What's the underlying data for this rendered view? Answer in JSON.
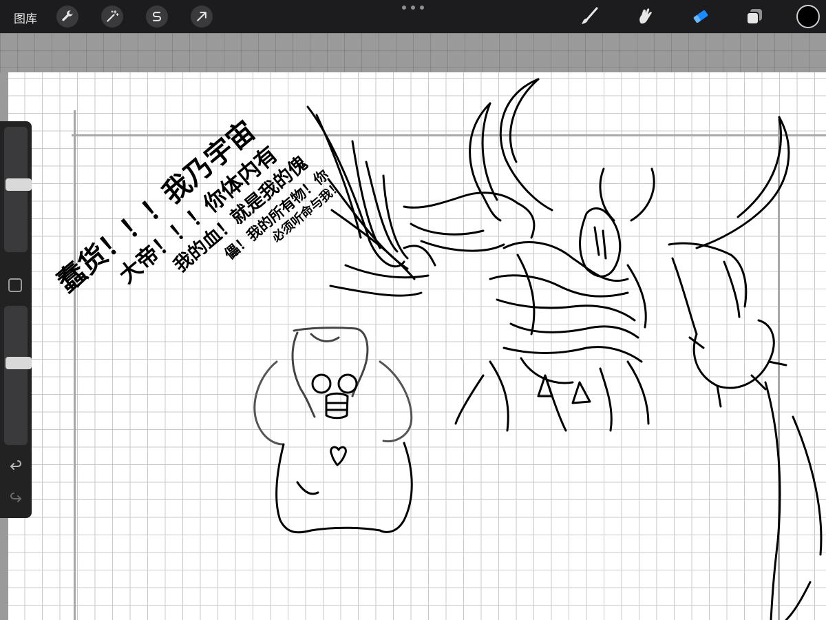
{
  "toolbar": {
    "gallery_label": "图库",
    "left_tools": [
      {
        "name": "actions",
        "icon": "wrench-icon"
      },
      {
        "name": "adjustments",
        "icon": "magic-wand-icon"
      },
      {
        "name": "selection",
        "icon": "selection-s-icon"
      },
      {
        "name": "transform",
        "icon": "arrow-cursor-icon"
      }
    ],
    "right_tools": [
      {
        "name": "brush",
        "icon": "brush-icon",
        "active": false
      },
      {
        "name": "smudge",
        "icon": "smudge-icon",
        "active": false
      },
      {
        "name": "eraser",
        "icon": "eraser-icon",
        "active": true
      },
      {
        "name": "layers",
        "icon": "layers-icon",
        "active": false
      }
    ],
    "active_color": "#000000",
    "accent_color": "#1a8cff"
  },
  "sidebar": {
    "brush_size_level": 0.54,
    "opacity_level": 0.6,
    "modify_icon": "square-icon",
    "undo_icon": "undo-icon",
    "redo_icon": "redo-icon"
  },
  "canvas": {
    "speech_lines": [
      "蠢货！！！我乃宇宙",
      "大帝！！！你体内有",
      "我的血！就是我的傀",
      "儡！我的所有物！你",
      "必须听命与我！"
    ]
  }
}
